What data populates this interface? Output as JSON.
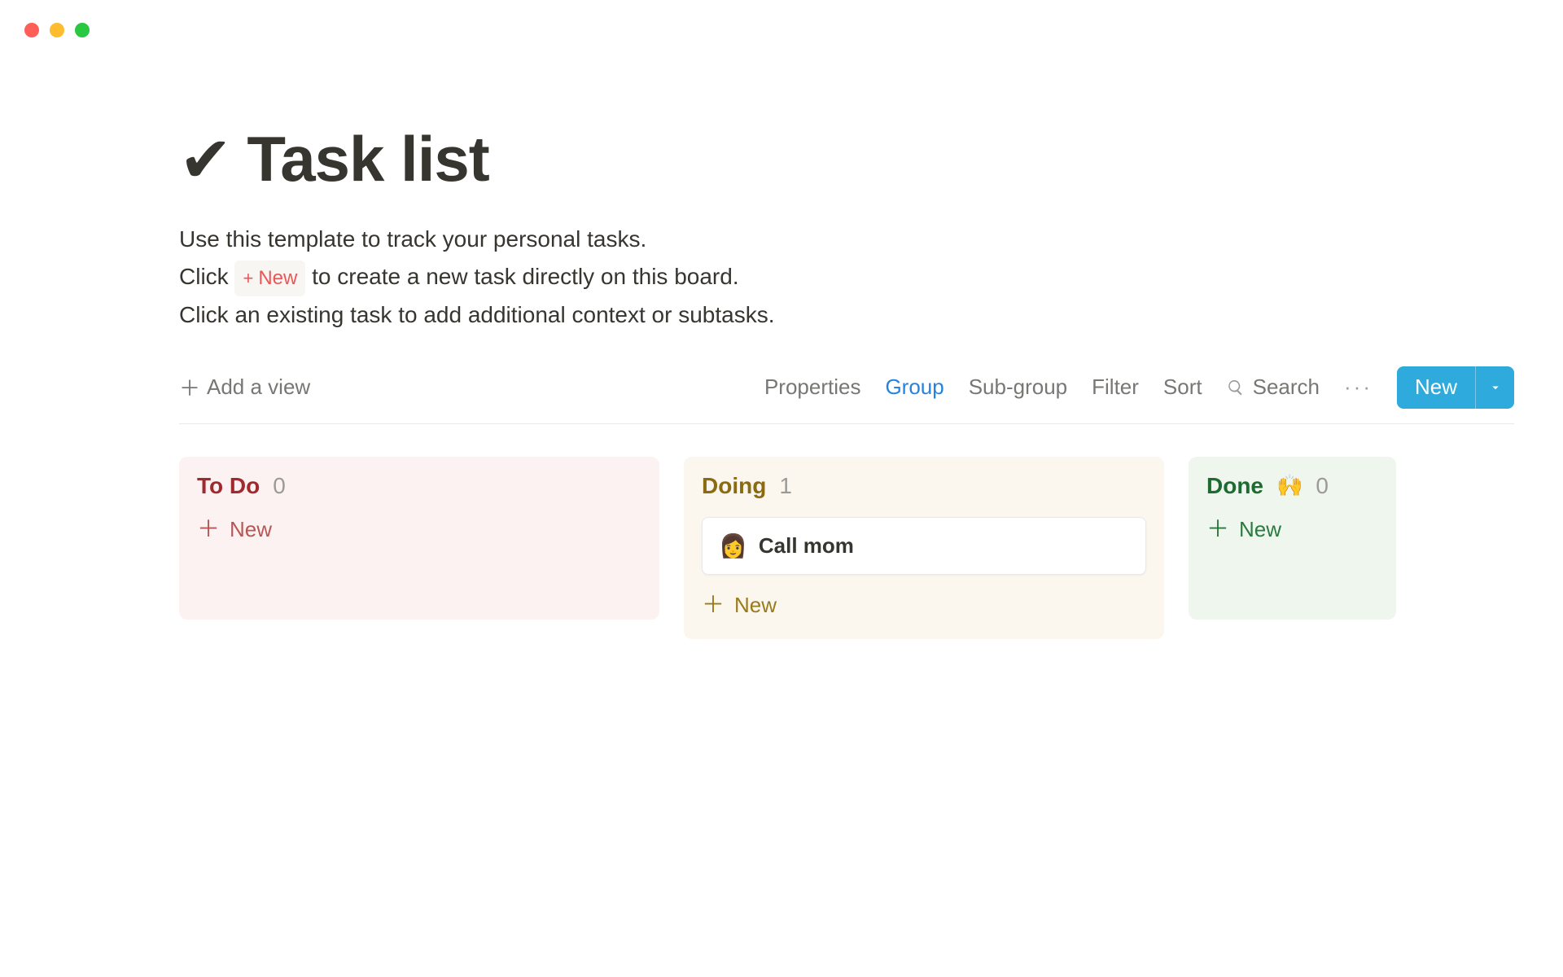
{
  "header": {
    "icon": "✔",
    "title": "Task list"
  },
  "description": {
    "line1": "Use this template to track your personal tasks.",
    "line2_before": "Click ",
    "new_chip_plus": "+",
    "new_chip_label": "New",
    "line2_after": " to create a new task directly on this board.",
    "line3": "Click an existing task to add additional context or subtasks."
  },
  "toolbar": {
    "add_view": "Add a view",
    "properties": "Properties",
    "group": "Group",
    "sub_group": "Sub-group",
    "filter": "Filter",
    "sort": "Sort",
    "search": "Search",
    "more": "···",
    "new_button": "New"
  },
  "columns": [
    {
      "key": "todo",
      "title": "To Do",
      "emoji": "",
      "count": 0,
      "cards": [],
      "new_label": "New",
      "theme": "col-todo",
      "width": "col-wide"
    },
    {
      "key": "doing",
      "title": "Doing",
      "emoji": "",
      "count": 1,
      "cards": [
        {
          "emoji": "👩",
          "title": "Call mom"
        }
      ],
      "new_label": "New",
      "theme": "col-doing",
      "width": "col-wide"
    },
    {
      "key": "done",
      "title": "Done",
      "emoji": "🙌",
      "count": 0,
      "cards": [],
      "new_label": "New",
      "theme": "col-done",
      "width": "col-narrow"
    }
  ]
}
